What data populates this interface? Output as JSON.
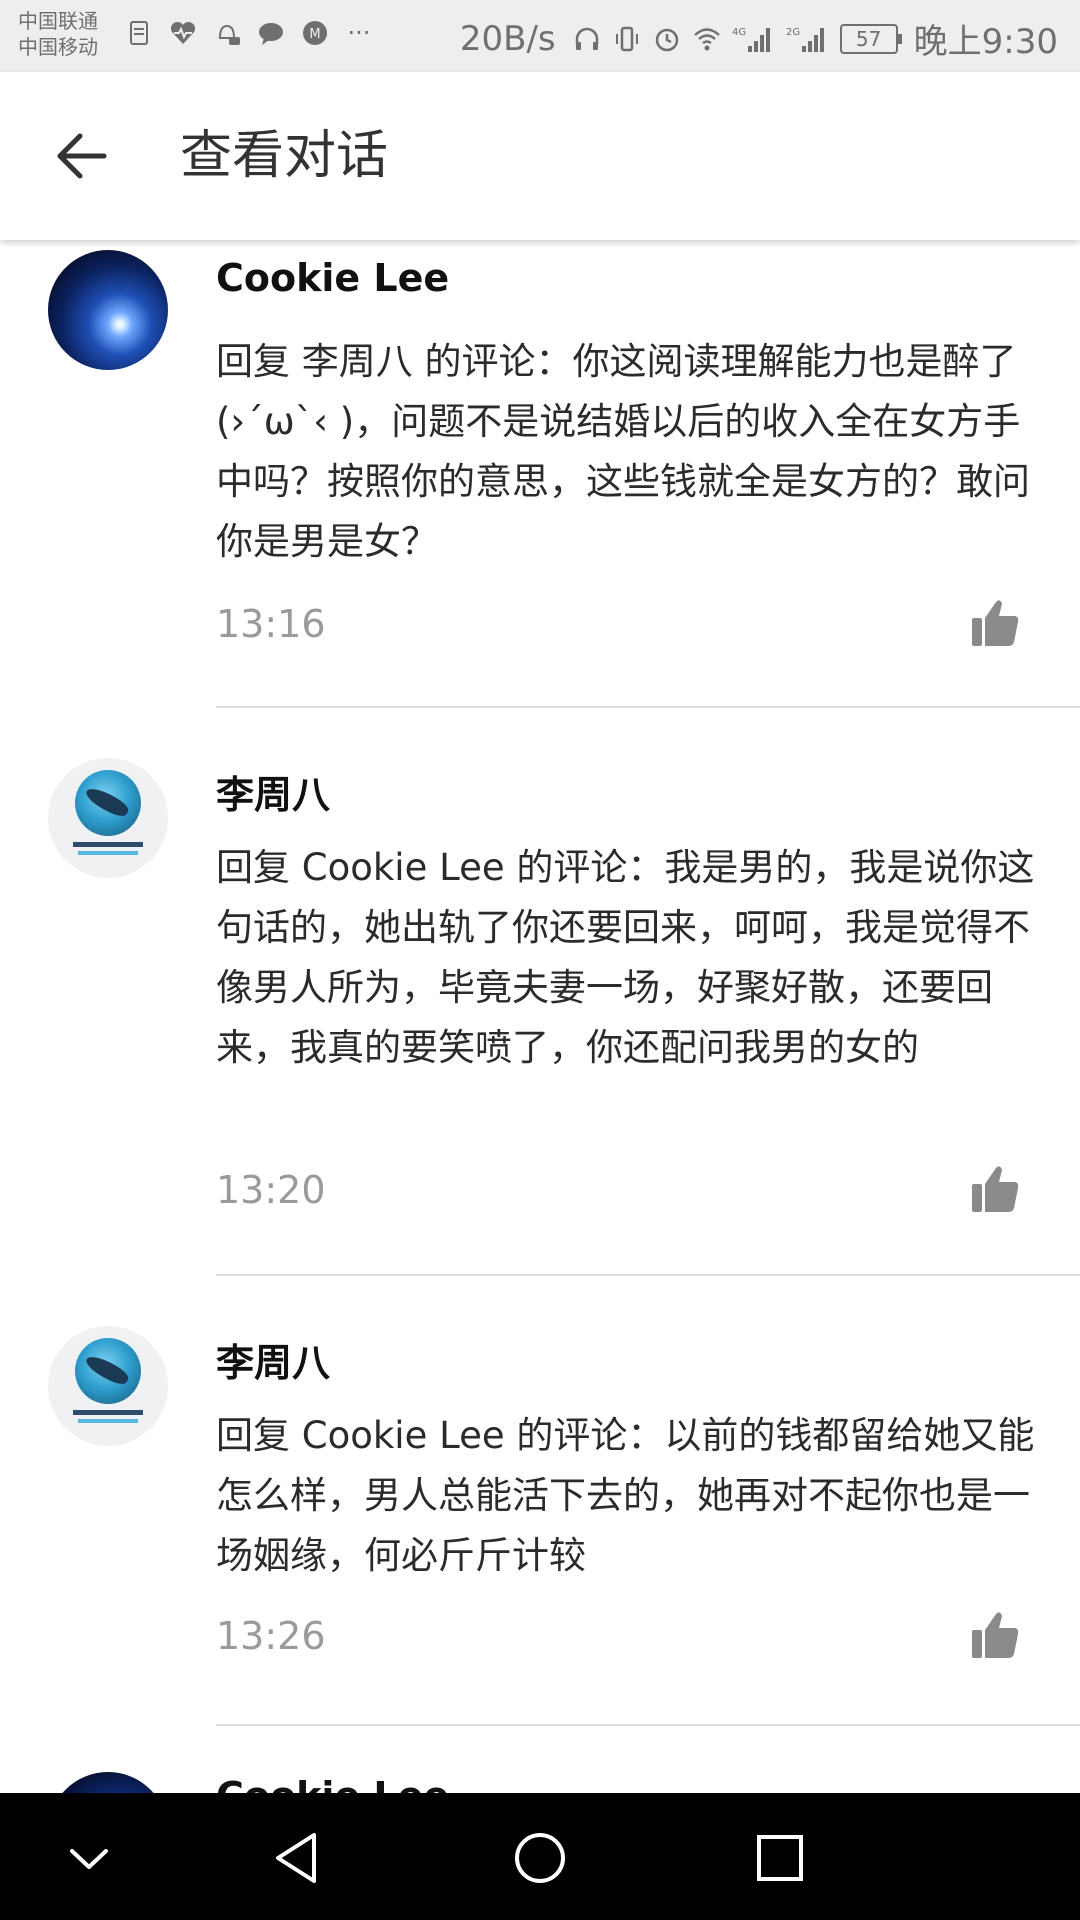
{
  "status_bar": {
    "carrier_1": "中国联通",
    "carrier_2": "中国移动",
    "left_icons": [
      "document-icon",
      "heart-pulse-icon",
      "chat-bell-icon",
      "message-bubble-icon",
      "app-badge-icon",
      "more-dots-icon"
    ],
    "more": "···",
    "net_speed": "20B/s",
    "battery": "57",
    "time": "晚上9:30",
    "signal_1": "4G",
    "signal_2": "2G"
  },
  "app_bar": {
    "title": "查看对话"
  },
  "comments": [
    {
      "avatar": "earth-avatar",
      "name": "Cookie Lee",
      "text": "回复 李周八 的评论：你这阅读理解能力也是醉了(›´ω`‹ )，问题不是说结婚以后的收入全在女方手中吗？按照你的意思，这些钱就全是女方的？敢问你是男是女？",
      "time": "13:16"
    },
    {
      "avatar": "fish-avatar",
      "name": "李周八",
      "text": "回复 Cookie Lee 的评论：我是男的，我是说你这句话的，她出轨了你还要回来，呵呵，我是觉得不像男人所为，毕竟夫妻一场，好聚好散，还要回来，我真的要笑喷了，你还配问我男的女的",
      "time": "13:20"
    },
    {
      "avatar": "fish-avatar",
      "name": "李周八",
      "text": "回复 Cookie Lee 的评论：以前的钱都留给她又能怎么样，男人总能活下去的，她再对不起你也是一场姻缘，何必斤斤计较",
      "time": "13:26"
    },
    {
      "avatar": "earth-avatar",
      "name": "Cookie Lee",
      "text": "",
      "time": ""
    }
  ],
  "nav_bar": {
    "buttons": [
      "collapse-icon",
      "back-triangle-icon",
      "home-circle-icon",
      "recents-square-icon"
    ]
  },
  "colors": {
    "status_bar_bg": "#eeeeee",
    "text_primary": "#111111",
    "text_secondary": "#9a9a9a",
    "like_icon": "#8a8a8a",
    "nav_bar_bg": "#000000"
  }
}
